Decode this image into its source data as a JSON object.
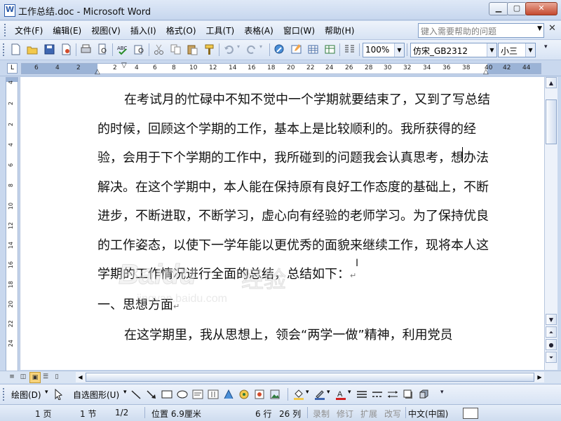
{
  "window": {
    "title": "工作总结.doc - Microsoft Word",
    "min_label": "▁",
    "max_label": "▢",
    "close_label": "✕"
  },
  "menu": {
    "items": [
      "文件(F)",
      "编辑(E)",
      "视图(V)",
      "插入(I)",
      "格式(O)",
      "工具(T)",
      "表格(A)",
      "窗口(W)",
      "帮助(H)"
    ],
    "help_placeholder": "键入需要帮助的问题",
    "close_label": "✕"
  },
  "toolbar": {
    "zoom": "100%",
    "font": "仿宋_GB2312",
    "size": "小三"
  },
  "ruler": {
    "h_numbers": [
      "6",
      "4",
      "2",
      "2",
      "4",
      "6",
      "8",
      "10",
      "12",
      "14",
      "16",
      "18",
      "20",
      "22",
      "24",
      "26",
      "28",
      "30",
      "32",
      "34",
      "36",
      "38",
      "40",
      "42",
      "44"
    ],
    "v_numbers": [
      "4",
      "2",
      "2",
      "4",
      "6",
      "8",
      "10",
      "12",
      "14",
      "16",
      "18",
      "20",
      "22",
      "24"
    ],
    "corner": "L"
  },
  "document": {
    "paragraphs": [
      {
        "text": "在考试月的忙碌中不知不觉中一个学期就要结束了，又到了写总结的时候，回顾这个学期的工作，基本上是比较顺利的。我所获得的经验，会用于下个学期的工作中，我所碰到的问题我会认真思考，想办法解决。在这个学期中，本人能在保持原有良好工作态度的基础上，不断进步，不断进取，不断学习，虚心向有经验的老师学习。为了保持优良的工作姿态，以使下一学年能以更优秀的面貌来继续工作，现将本人这学期的工作情况进行全面的总结，总结如下：",
        "indent": true
      },
      {
        "text": "一、思想方面",
        "indent": false
      },
      {
        "text": "在这学期里，我从思想上，领会“两学一做”精神，利用党员",
        "indent": true
      }
    ],
    "paragraph_mark": "↵"
  },
  "watermark": {
    "brand": "Baidu",
    "cn": "经验",
    "url": "jingyan.baidu.com"
  },
  "drawing": {
    "draw_label": "绘图(D)",
    "autoshape_label": "自选图形(U)"
  },
  "status": {
    "page": "1 页",
    "section": "1 节",
    "pages": "1/2",
    "position": "位置 6.9厘米",
    "line": "6 行",
    "column": "26 列",
    "rec": "录制",
    "trk": "修订",
    "ext": "扩展",
    "ovr": "改写",
    "lang": "中文(中国)"
  },
  "colors": {
    "chrome": "#c9d8ee",
    "page": "#ffffff",
    "accent": "#2a5aa8"
  }
}
